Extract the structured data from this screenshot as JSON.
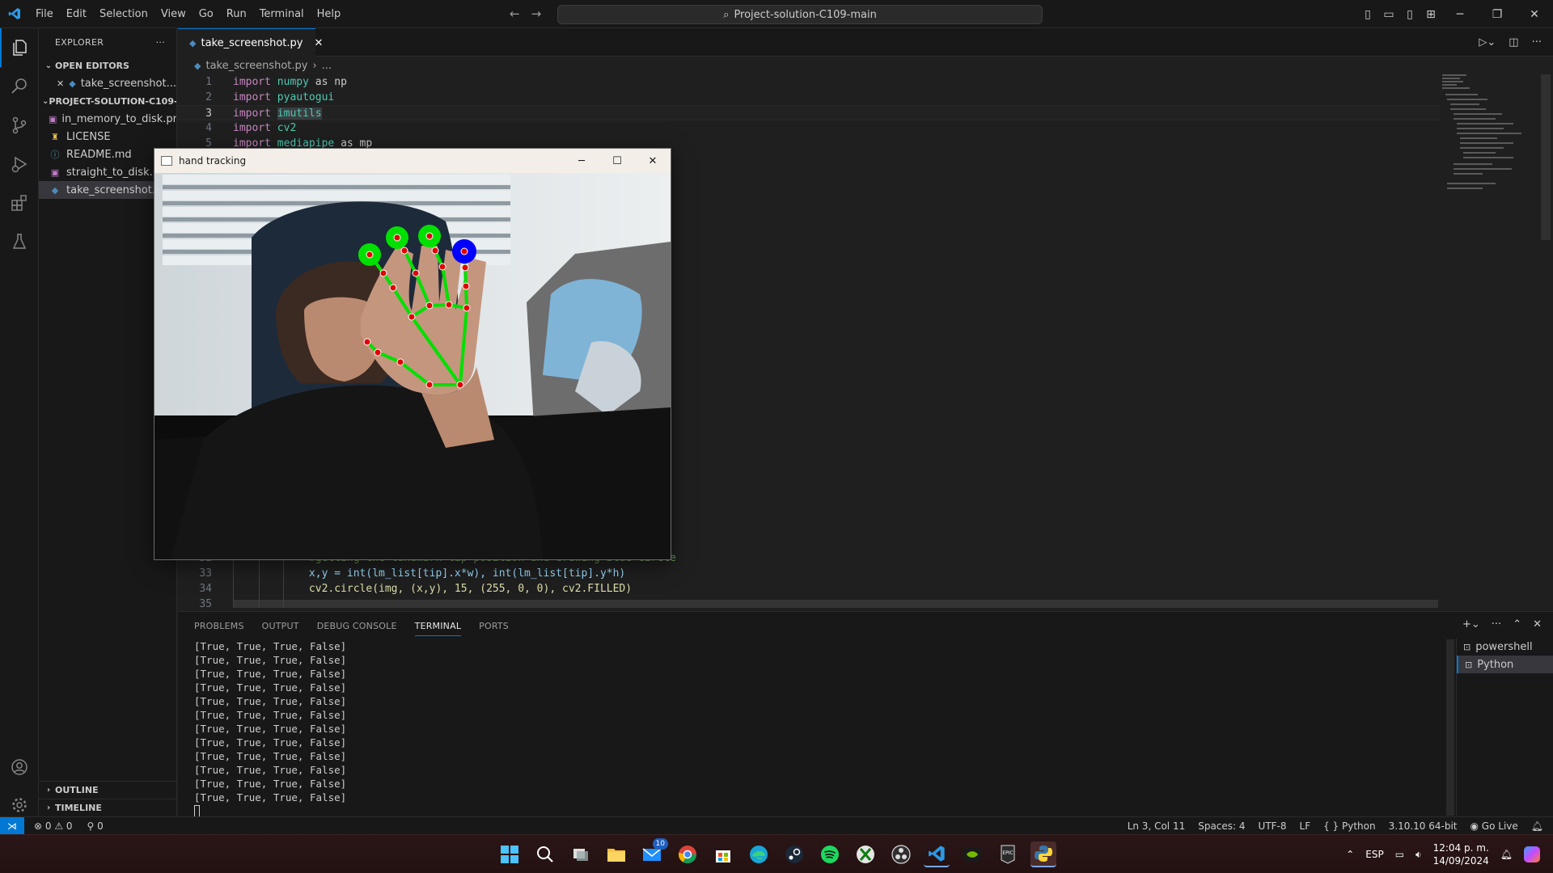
{
  "menu": [
    "File",
    "Edit",
    "Selection",
    "View",
    "Go",
    "Run",
    "Terminal",
    "Help"
  ],
  "command_center": "Project-solution-C109-main",
  "sidebar": {
    "title": "EXPLORER",
    "open_editors_label": "OPEN EDITORS",
    "open_editor_file": "take_screenshot....",
    "project_label": "PROJECT-SOLUTION-C109-...",
    "files": [
      "in_memory_to_disk.png",
      "LICENSE",
      "README.md",
      "straight_to_disk.png",
      "take_screenshot.py"
    ],
    "outline_label": "OUTLINE",
    "timeline_label": "TIMELINE"
  },
  "editor": {
    "tab_label": "take_screenshot.py",
    "breadcrumb_file": "take_screenshot.py",
    "breadcrumb_more": "...",
    "code_top": [
      {
        "n": "1",
        "kw": "import",
        "mod": "numpy",
        "rest": " as np"
      },
      {
        "n": "2",
        "kw": "import",
        "mod": "pyautogui",
        "rest": ""
      },
      {
        "n": "3",
        "kw": "import",
        "mod": "imutils",
        "rest": ""
      },
      {
        "n": "4",
        "kw": "import",
        "mod": "cv2",
        "rest": ""
      },
      {
        "n": "5",
        "kw": "import",
        "mod": "mediapipe",
        "rest": " as mp"
      }
    ],
    "line32_comment": "#getting the landmark tip position and drawing blue circle",
    "line33": "x,y = int(lm_list[tip].x*w), int(lm_list[tip].y*h)",
    "line34": "cv2.circle(img, (x,y), 15, (255, 0, 0), cv2.FILLED)",
    "line_numbers_bottom": [
      "32",
      "33",
      "34",
      "35"
    ]
  },
  "panel": {
    "tabs": [
      "PROBLEMS",
      "OUTPUT",
      "DEBUG CONSOLE",
      "TERMINAL",
      "PORTS"
    ],
    "active_tab": "TERMINAL",
    "terminal_lines": [
      "[True, True, True, False]",
      "[True, True, True, False]",
      "[True, True, True, False]",
      "[True, True, True, False]",
      "[True, True, True, False]",
      "[True, True, True, False]",
      "[True, True, True, False]",
      "[True, True, True, False]",
      "[True, True, True, False]",
      "[True, True, True, False]",
      "[True, True, True, False]",
      "[True, True, True, False]"
    ],
    "terminals": [
      "powershell",
      "Python"
    ]
  },
  "status": {
    "errors": "0",
    "warnings": "0",
    "ports": "0",
    "position": "Ln 3, Col 11",
    "spaces": "Spaces: 4",
    "encoding": "UTF-8",
    "eol": "LF",
    "language": "Python",
    "interpreter": "3.10.10 64-bit",
    "go_live": "Go Live"
  },
  "hand_window": {
    "title": "hand tracking",
    "fingers_up": [
      true,
      true,
      true,
      false
    ]
  },
  "taskbar": {
    "mail_badge": "10",
    "lang": "ESP",
    "time": "12:04 p. m.",
    "date": "14/09/2024"
  },
  "colors": {
    "accent": "#0078d4",
    "landmark_line": "#00e000",
    "landmark_point": "#e00000",
    "tip_blue": "#0000ff"
  }
}
